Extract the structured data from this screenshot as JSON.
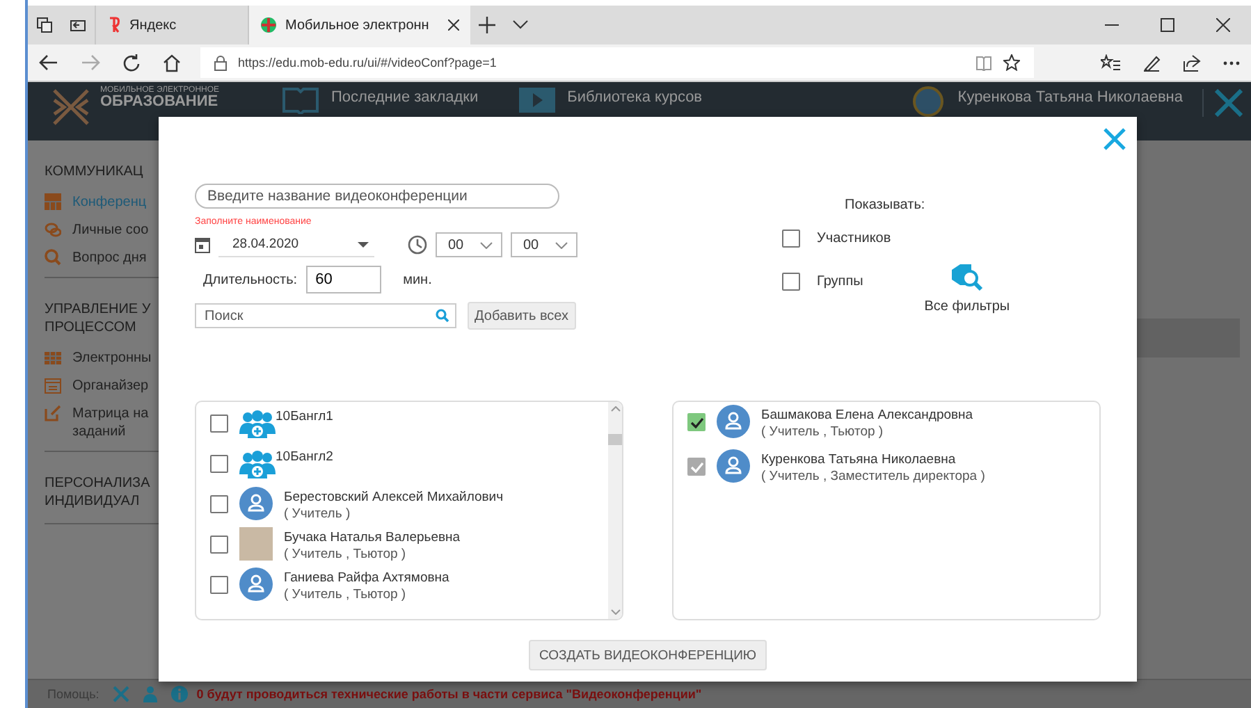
{
  "browser": {
    "tabs": [
      {
        "title": "Яндекс",
        "selected": false
      },
      {
        "title": "Мобильное электронн",
        "selected": true
      }
    ],
    "url": "https://edu.mob-edu.ru/ui/#/videoConf?page=1"
  },
  "header": {
    "logo_top": "МОБИЛЬНОЕ ЭЛЕКТРОННОЕ",
    "logo_bottom": "ОБРАЗОВАНИЕ",
    "nav": [
      "Последние закладки",
      "Библиотека курсов"
    ],
    "user": "Куренкова Татьяна Николаевна"
  },
  "sidebar": {
    "sections": [
      {
        "title": [
          "КОММУНИКАЦ"
        ],
        "items": [
          {
            "kind": "conference",
            "label": [
              "Конференц"
            ],
            "selected": true
          },
          {
            "kind": "chat",
            "label": [
              "Личные соо"
            ],
            "selected": false
          },
          {
            "kind": "question",
            "label": [
              "Вопрос дня"
            ],
            "selected": false
          }
        ]
      },
      {
        "title": [
          "УПРАВЛЕНИЕ У",
          "ПРОЦЕССОМ"
        ],
        "items": [
          {
            "kind": "journal",
            "label": [
              "Электронны"
            ],
            "selected": false
          },
          {
            "kind": "calendar",
            "label": [
              "Органайзер"
            ],
            "selected": false
          },
          {
            "kind": "edit",
            "label": [
              "Матрица на",
              "заданий"
            ],
            "selected": false
          }
        ]
      },
      {
        "title": [
          "ПЕРСОНАЛИЗА",
          "ИНДИВИДУАЛ"
        ]
      }
    ]
  },
  "modal": {
    "name_placeholder": "Введите название видеоконференции",
    "error": "Заполните наименование",
    "date": "28.04.2020",
    "hour": "00",
    "minute": "00",
    "duration_label": "Длительность:",
    "duration": "60",
    "duration_unit": "мин.",
    "search_placeholder": "Поиск",
    "add_all": "Добавить всех",
    "show_label": "Показывать:",
    "filters": [
      {
        "label": "Участников",
        "checked": false
      },
      {
        "label": "Группы",
        "checked": false
      }
    ],
    "all_filters": "Все фильтры",
    "available": [
      {
        "kind": "group",
        "name": "10Бангл1",
        "checked": false
      },
      {
        "kind": "group",
        "name": "10Бангл2",
        "checked": false
      },
      {
        "kind": "person",
        "name": "Берестовский Алексей Михайлович",
        "role": "( Учитель )",
        "checked": false
      },
      {
        "kind": "photo",
        "name": "Бучака Наталья Валерьевна",
        "role": "( Учитель , Тьютор )",
        "checked": false
      },
      {
        "kind": "person",
        "name": "Ганиева Райфа Ахтямовна",
        "role": "( Учитель , Тьютор )",
        "checked": false
      }
    ],
    "selected_list": [
      {
        "name": "Башмакова Елена Александровна",
        "role": "( Учитель , Тьютор )",
        "checked": true,
        "disabled": false
      },
      {
        "name": "Куренкова Татьяна Николаевна",
        "role": "( Учитель , Заместитель директора )",
        "checked": true,
        "disabled": true
      }
    ],
    "create": "СОЗДАТЬ ВИДЕОКОНФЕРЕНЦИЮ"
  },
  "status_bar": {
    "help": "Помощь:",
    "notice": "0 будут проводиться технические работы в части сервиса \"Видеоконференции\""
  }
}
